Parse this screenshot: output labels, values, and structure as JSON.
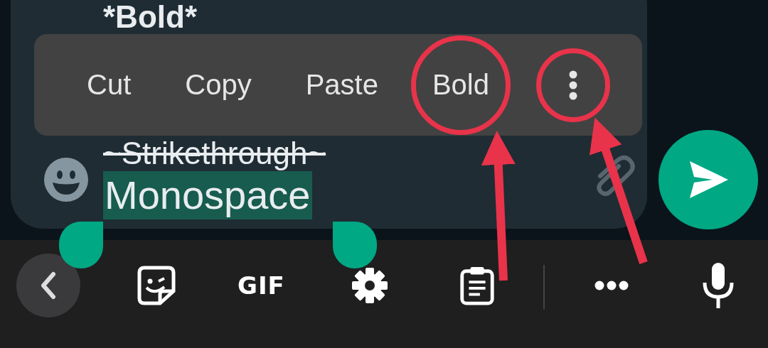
{
  "message_input": {
    "lines": [
      {
        "text": "*Bold*",
        "kind": "bold",
        "selected": false
      },
      {
        "text": "~Strikethrough~",
        "kind": "strike",
        "selected": false
      },
      {
        "text": "Monospace",
        "kind": "mono",
        "selected": true
      }
    ]
  },
  "context_menu": {
    "items": [
      {
        "kind": "text",
        "label": "Cut",
        "highlighted": false
      },
      {
        "kind": "text",
        "label": "Copy",
        "highlighted": false
      },
      {
        "kind": "text",
        "label": "Paste",
        "highlighted": false
      },
      {
        "kind": "text",
        "label": "Bold",
        "highlighted": true
      },
      {
        "kind": "more",
        "highlighted": true
      }
    ]
  },
  "keyboard_toolbar": {
    "gif_label": "GIF"
  }
}
